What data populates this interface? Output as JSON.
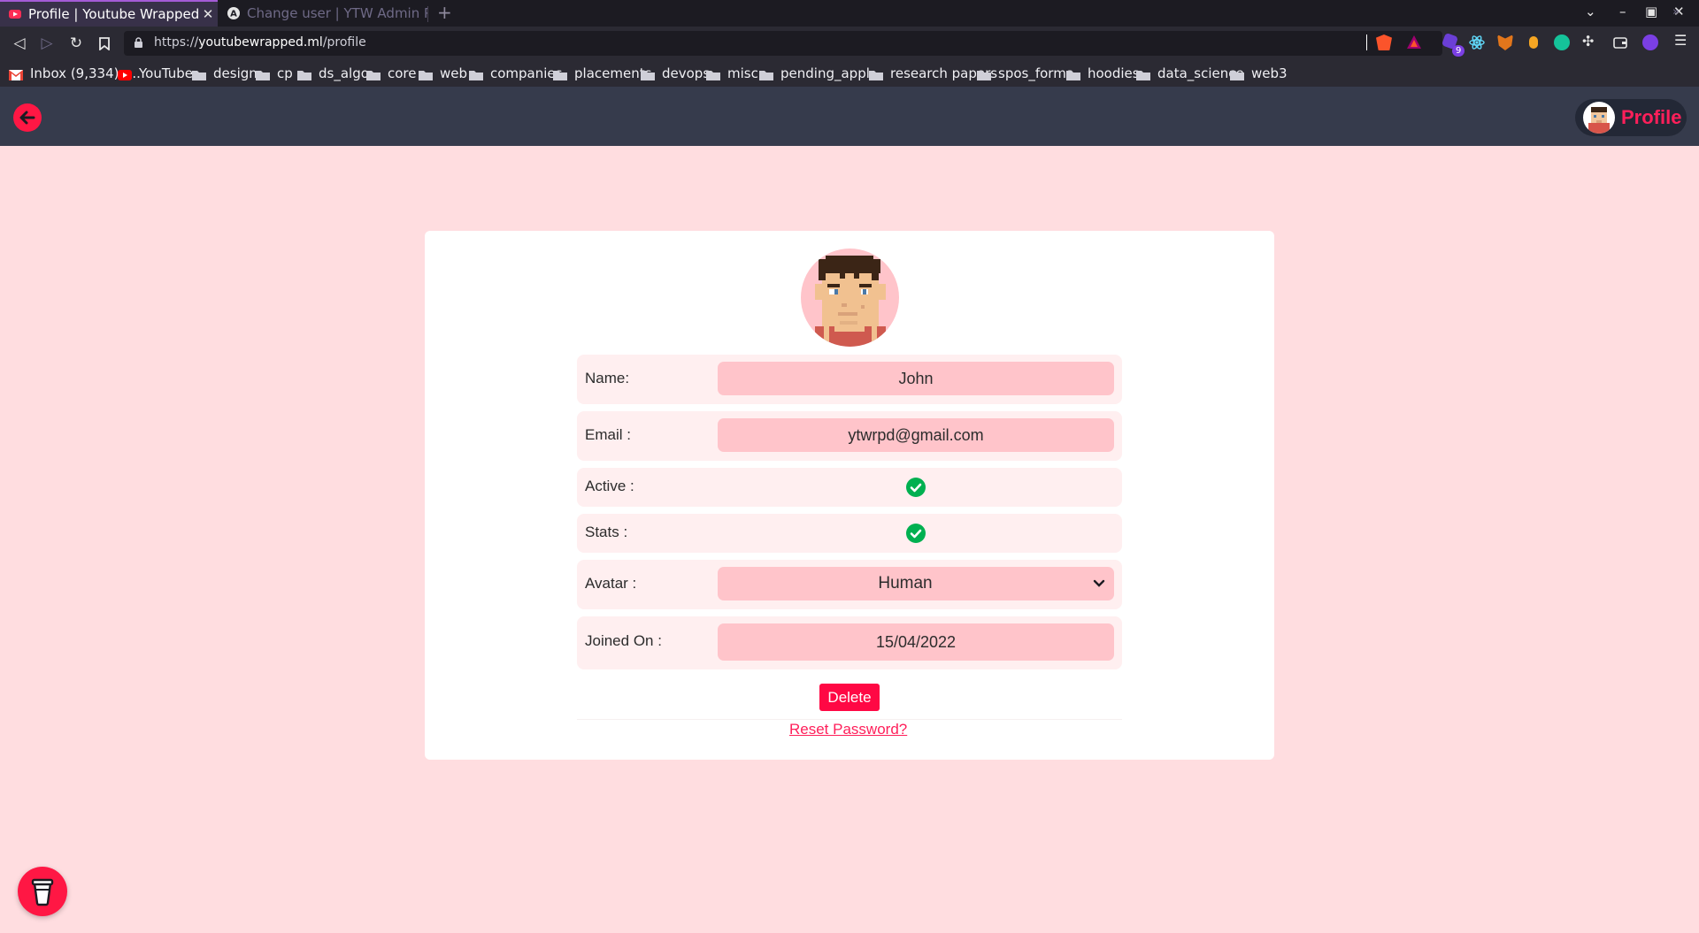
{
  "browser": {
    "tabs": [
      {
        "title": "Profile | Youtube Wrapped",
        "active": true
      },
      {
        "title": "Change user | YTW Admin Panel",
        "active": false
      }
    ],
    "url": {
      "scheme": "https://",
      "host": "youtubewrapped.ml",
      "path": "/profile"
    },
    "extension_badge": "9",
    "bookmarks": [
      {
        "label": "Inbox (9,334) -...",
        "icon": "gmail-icon"
      },
      {
        "label": "YouTube",
        "icon": "youtube-icon"
      },
      {
        "label": "design",
        "icon": "folder-icon"
      },
      {
        "label": "cp",
        "icon": "folder-icon"
      },
      {
        "label": "ds_algo",
        "icon": "folder-icon"
      },
      {
        "label": "core",
        "icon": "folder-icon"
      },
      {
        "label": "web",
        "icon": "folder-icon"
      },
      {
        "label": "companies",
        "icon": "folder-icon"
      },
      {
        "label": "placements",
        "icon": "folder-icon"
      },
      {
        "label": "devops",
        "icon": "folder-icon"
      },
      {
        "label": "misc",
        "icon": "folder-icon"
      },
      {
        "label": "pending_appl...",
        "icon": "folder-icon"
      },
      {
        "label": "research papers",
        "icon": "folder-icon"
      },
      {
        "label": "spos_forms",
        "icon": "folder-icon"
      },
      {
        "label": "hoodies",
        "icon": "folder-icon"
      },
      {
        "label": "data_science",
        "icon": "folder-icon"
      },
      {
        "label": "web3",
        "icon": "folder-icon"
      }
    ]
  },
  "header": {
    "profile_label": "Profile"
  },
  "profile": {
    "name_label": "Name:",
    "name_value": "John",
    "email_label": "Email :",
    "email_value": "ytwrpd@gmail.com",
    "active_label": "Active :",
    "active": true,
    "stats_label": "Stats :",
    "stats": true,
    "avatar_label": "Avatar :",
    "avatar_value": "Human",
    "joined_label": "Joined On :",
    "joined_value": "15/04/2022"
  },
  "actions": {
    "delete_label": "Delete",
    "reset_label": "Reset Password?"
  },
  "colors": {
    "accent": "#ff1744",
    "page_bg": "#ffdde0",
    "header_bg": "#363b4c",
    "field_bg": "#ffc4ca",
    "check": "#00b050"
  }
}
